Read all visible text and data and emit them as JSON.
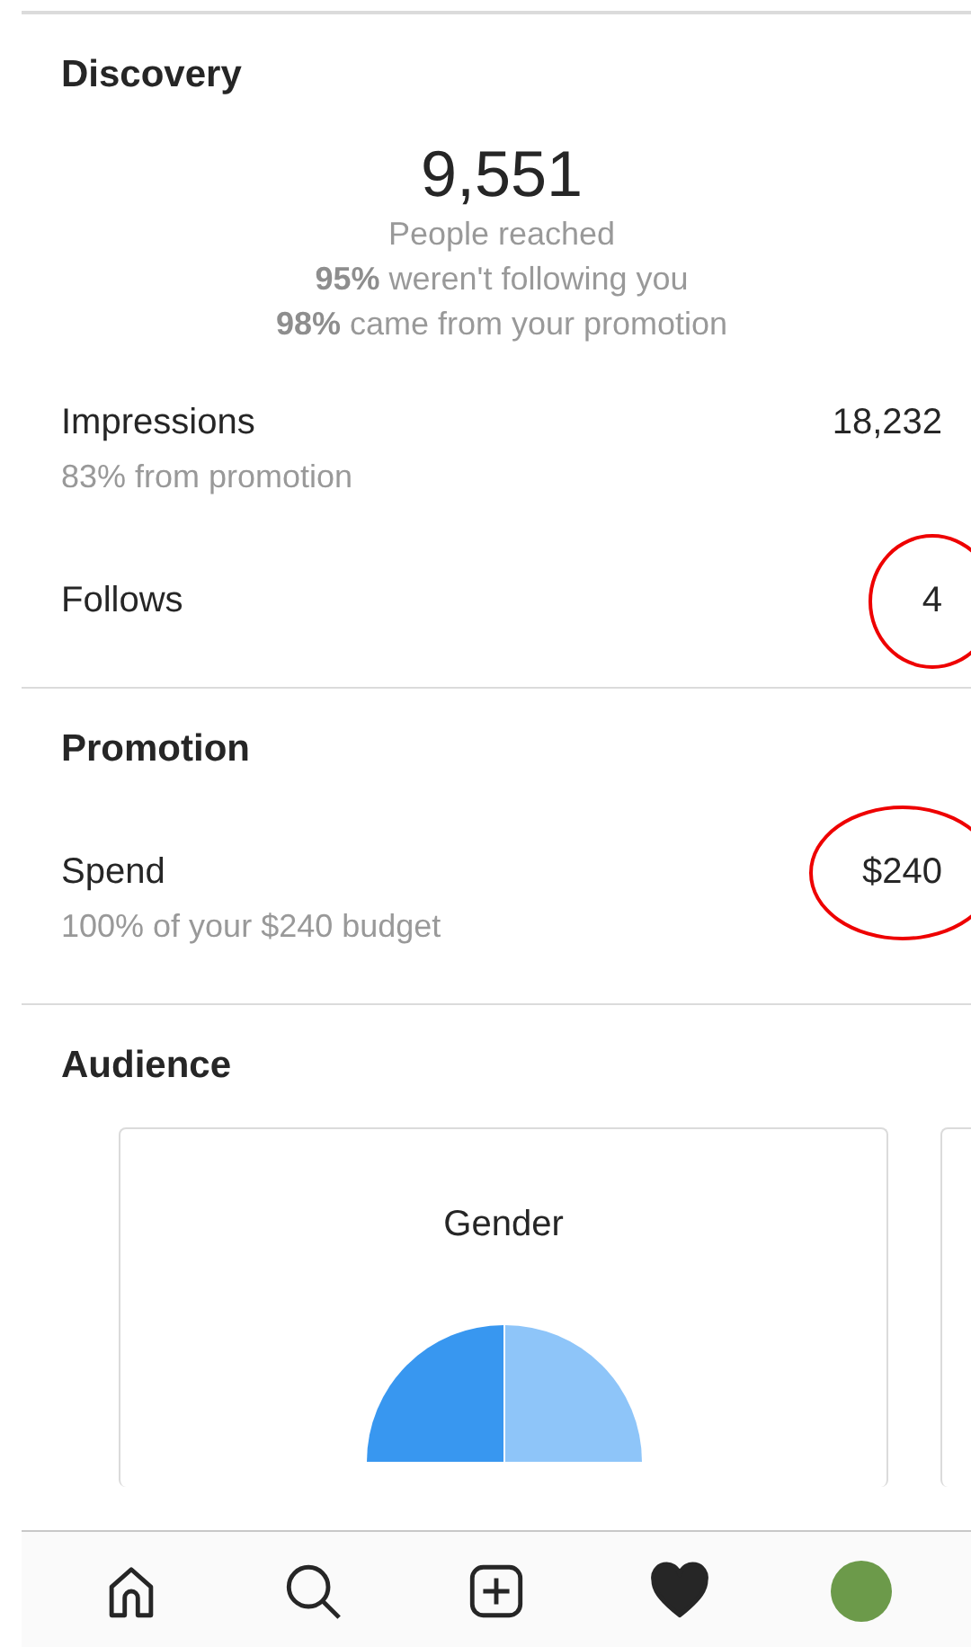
{
  "sections": [
    {
      "title": "Discovery",
      "headline": {
        "value": "9,551",
        "lines": [
          "People reached",
          "**95%** weren't following you",
          "**98%** came from your promotion"
        ]
      },
      "rows": [
        {
          "label": "Impressions",
          "value": "18,232",
          "note": "83% from promotion",
          "circled": false
        },
        {
          "label": "Follows",
          "value": "4",
          "circled": true
        }
      ]
    },
    {
      "title": "Promotion",
      "rows": [
        {
          "label": "Spend",
          "value": "$240",
          "note": "100% of your $240 budget",
          "circled": true
        }
      ]
    },
    {
      "title": "Audience",
      "cards": [
        {
          "title": "Gender"
        }
      ]
    }
  ],
  "nav": [
    {
      "kind": "home",
      "selected": false
    },
    {
      "kind": "search",
      "selected": false
    },
    {
      "kind": "add",
      "selected": false
    },
    {
      "kind": "heart",
      "selected": true
    },
    {
      "kind": "avatar",
      "selected": false
    }
  ]
}
